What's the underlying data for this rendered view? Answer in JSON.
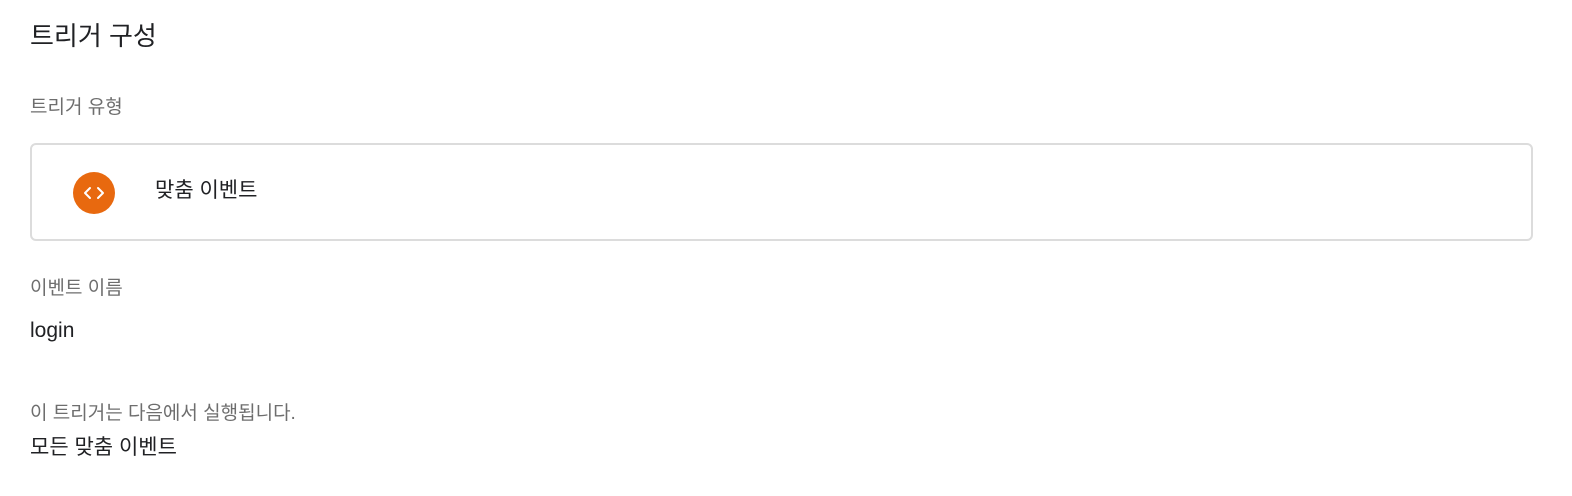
{
  "page": {
    "title": "트리거 구성"
  },
  "trigger_type": {
    "label": "트리거 유형",
    "selected_name": "맞춤 이벤트",
    "icon": "code-brackets-icon",
    "icon_color": "#e8690f"
  },
  "event_name": {
    "label": "이벤트 이름",
    "value": "login"
  },
  "runs_on": {
    "label": "이 트리거는 다음에서 실행됩니다.",
    "value": "모든 맞춤 이벤트"
  }
}
